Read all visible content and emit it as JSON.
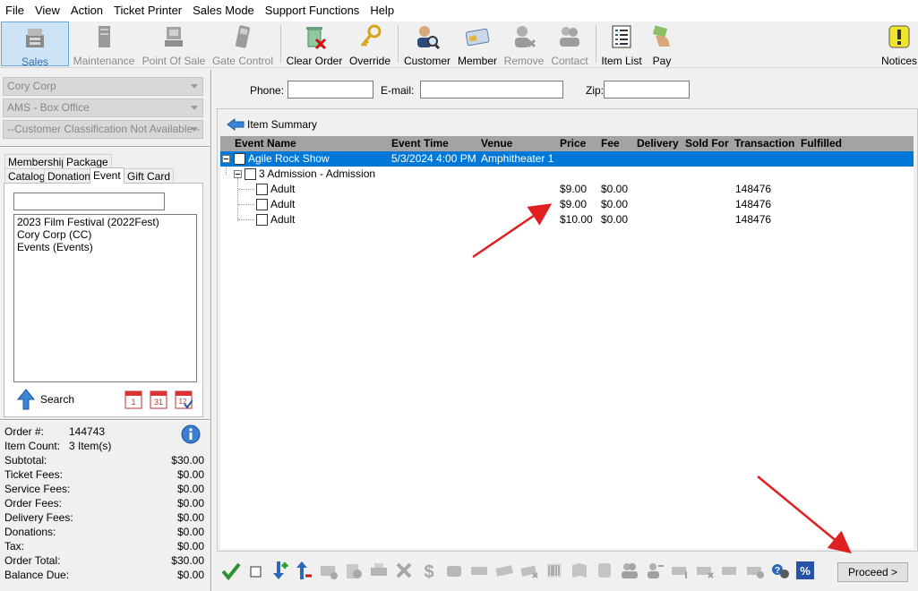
{
  "menu": [
    "File",
    "View",
    "Action",
    "Ticket Printer",
    "Sales Mode",
    "Support Functions",
    "Help"
  ],
  "toolbar": {
    "sales": "Sales",
    "maintenance": "Maintenance",
    "point_of_sale": "Point Of Sale",
    "gate_control": "Gate Control",
    "clear_order": "Clear Order",
    "override": "Override",
    "customer": "Customer",
    "member": "Member",
    "remove": "Remove",
    "contact": "Contact",
    "item_list": "Item List",
    "pay": "Pay",
    "notices": "Notices"
  },
  "left": {
    "company": "Cory Corp",
    "office": "AMS - Box Office",
    "classification": "--Customer Classification Not Available--",
    "tabs": {
      "membership": "Membership",
      "package": "Package",
      "catalog": "Catalog",
      "donation": "Donation",
      "event": "Event",
      "gift_card": "Gift Card"
    },
    "search_value": "",
    "list": [
      "2023 Film Festival  (2022Fest)",
      "Cory Corp  (CC)",
      "Events  (Events)"
    ],
    "search_label": "Search",
    "calendar_icons": [
      "1",
      "31",
      "12"
    ]
  },
  "order": {
    "order_no_label": "Order #:",
    "order_no": "144743",
    "item_count_label": "Item Count:",
    "item_count": "3 Item(s)",
    "rows": [
      {
        "label": "Subtotal:",
        "value": "$30.00"
      },
      {
        "label": "Ticket Fees:",
        "value": "$0.00"
      },
      {
        "label": "Service Fees:",
        "value": "$0.00"
      },
      {
        "label": "Order Fees:",
        "value": "$0.00"
      },
      {
        "label": "Delivery Fees:",
        "value": "$0.00"
      },
      {
        "label": "Donations:",
        "value": "$0.00"
      },
      {
        "label": "Tax:",
        "value": "$0.00"
      },
      {
        "label": "Order Total:",
        "value": "$30.00"
      },
      {
        "label": "Balance Due:",
        "value": "$0.00"
      }
    ]
  },
  "contact": {
    "phone_label": "Phone:",
    "phone": "",
    "email_label": "E-mail:",
    "email": "",
    "zip_label": "Zip:",
    "zip": ""
  },
  "summary": {
    "title": "Item Summary",
    "headers": {
      "event_name": "Event Name",
      "event_time": "Event Time",
      "venue": "Venue",
      "price": "Price",
      "fee": "Fee",
      "delivery": "Delivery",
      "sold_for": "Sold For",
      "transaction": "Transaction",
      "fulfilled": "Fulfilled"
    },
    "event": {
      "name": "Agile Rock Show",
      "time": "5/3/2024 4:00 PM",
      "venue": "Amphitheater 1"
    },
    "group": "3 Admission - Admission",
    "items": [
      {
        "name": "Adult",
        "price": "$9.00",
        "fee": "$0.00",
        "transaction": "148476"
      },
      {
        "name": "Adult",
        "price": "$9.00",
        "fee": "$0.00",
        "transaction": "148476"
      },
      {
        "name": "Adult",
        "price": "$10.00",
        "fee": "$0.00",
        "transaction": "148476"
      }
    ]
  },
  "proceed": "Proceed >",
  "colors": {
    "selection": "#0078d7",
    "header": "#a3a3a3",
    "annotation": "#e02020"
  }
}
